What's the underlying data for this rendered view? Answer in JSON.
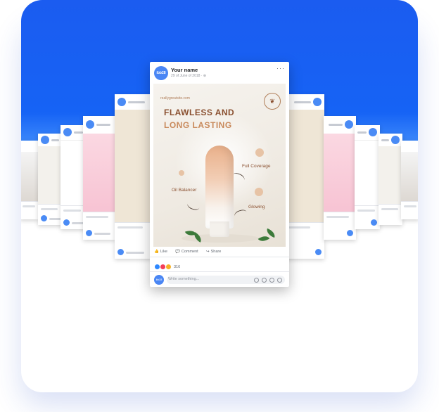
{
  "post": {
    "user_name": "Your name",
    "date": "29 of June of 2018 · ⊕",
    "avatar_text": "ibb28",
    "more": "···",
    "ad": {
      "url": "reallygreatsite.com",
      "headline_1": "FLAWLESS AND",
      "headline_2": "LONG LASTING",
      "features": [
        "Full Coverage",
        "Oil Balancer",
        "Glowing"
      ]
    },
    "actions": {
      "like": "Like",
      "comment": "Comment",
      "share": "Share"
    },
    "reaction_count": "316",
    "composer_placeholder": "Write something..."
  },
  "colors": {
    "brand_blue": "#1663f5",
    "avatar_blue": "#4a86f4",
    "brown_dark": "#8a5030",
    "brown_light": "#c98a5c"
  },
  "icons": [
    "more-icon",
    "like-icon",
    "comment-icon",
    "share-icon",
    "globe-icon",
    "emoji-icon",
    "camera-icon",
    "gif-icon",
    "sticker-icon"
  ]
}
